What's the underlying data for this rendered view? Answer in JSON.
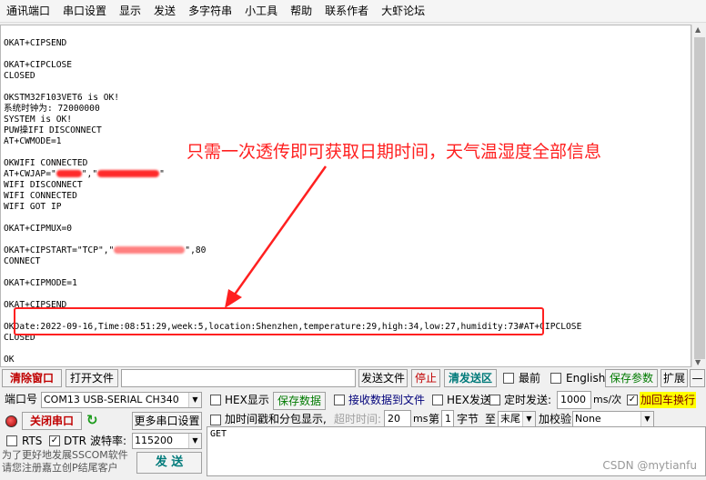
{
  "menu": [
    "通讯端口",
    "串口设置",
    "显示",
    "发送",
    "多字符串",
    "小工具",
    "帮助",
    "联系作者",
    "大虾论坛"
  ],
  "terminal": {
    "lines": [
      "",
      "OKAT+CIPSEND",
      "",
      "OKAT+CIPCLOSE",
      "CLOSED",
      "",
      "OKSTM32F103VET6 is OK!",
      "系统时钟为: 72000000",
      "SYSTEM is OK!",
      "PUW操IFI DISCONNECT",
      "AT+CWMODE=1",
      "",
      "OKWIFI CONNECTED",
      "AT+CWJAP=\"",
      "WIFI DISCONNECT",
      "WIFI CONNECTED",
      "WIFI GOT IP",
      "",
      "OKAT+CIPMUX=0",
      "",
      "OKAT+CIPSTART=\"TCP\",\"",
      "CONNECT",
      "",
      "OKAT+CIPMODE=1",
      "",
      "OKAT+CIPSEND",
      "",
      "OKDate:2022-09-16,Time:08:51:29,week:5,location:Shenzhen,temperature:29,high:34,low:27,humidity:73#AT+CIPCLOSE",
      "CLOSED",
      "",
      "OK"
    ],
    "cwjap_tail": "\"",
    "cipstart_tail": "\",80"
  },
  "annotation": "只需一次透传即可获取日期时间，天气温湿度全部信息",
  "toolbar": {
    "clear_window": "清除窗口",
    "open_file": "打开文件",
    "send_file": "发送文件",
    "stop": "停止",
    "clear_send": "清发送区",
    "topmost": "最前",
    "english": "English",
    "save_params": "保存参数",
    "expand": "扩展",
    "collapse": "—"
  },
  "port": {
    "label": "端口号",
    "value": "COM13 USB-SERIAL CH340",
    "close_port": "关闭串口",
    "more_settings": "更多串口设置",
    "rts": "RTS",
    "dtr": "DTR",
    "baud_label": "波特率:",
    "baud_value": "115200"
  },
  "options": {
    "hex_display": "HEX显示",
    "save_data": "保存数据",
    "recv_to_file": "接收数据到文件",
    "hex_send": "HEX发送",
    "timed_send": "定时发送:",
    "interval": "1000",
    "interval_unit": "ms/次",
    "add_crlf": "加回车换行",
    "timestamp_split": "加时间戳和分包显示,",
    "timeout_label": "超时时间:",
    "timeout_value": "20",
    "timeout_unit": "ms",
    "byte_num_prefix": "第",
    "byte_num": "1",
    "byte_unit": "字节",
    "to_label": "至",
    "to_value": "末尾",
    "checksum_label": "加校验",
    "checksum_value": "None"
  },
  "send_text": "GET",
  "send_button": "发 送",
  "promo": "为了更好地发展SSCOM软件\n请您注册嘉立创P结尾客户",
  "watermark": "CSDN @mytianfu"
}
